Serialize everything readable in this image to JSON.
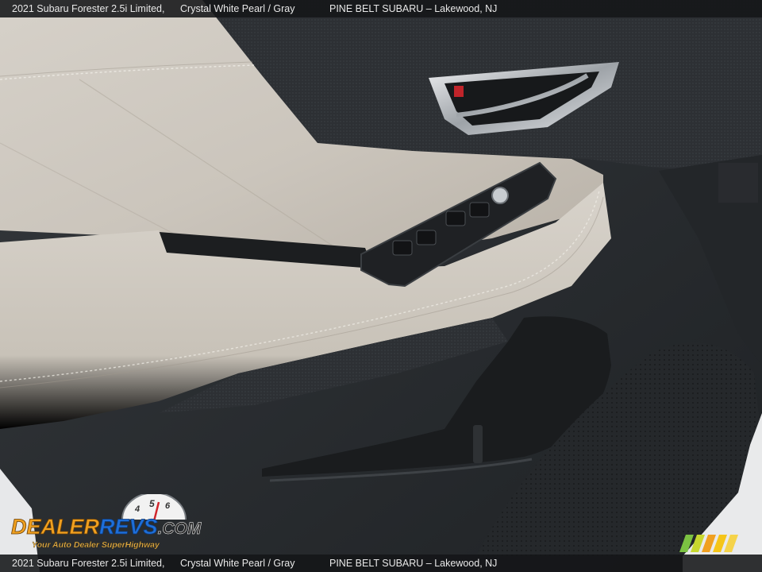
{
  "caption": {
    "vehicle": "2021 Subaru Forester 2.5i Limited,",
    "color": "Crystal White Pearl / Gray",
    "dealer": "PINE BELT SUBARU – Lakewood, NJ"
  },
  "watermark": {
    "brand": "DealerRevs.com",
    "tagline": "Your Auto Dealer SuperHighway",
    "gauge_digits": [
      "4",
      "5",
      "6"
    ]
  },
  "colors": {
    "leather": "#cfc9c0",
    "door_panel": "#2a2d30",
    "chrome": "#c9ccd0",
    "brand_orange": "#f0a020",
    "brand_blue": "#1e6fd9"
  }
}
